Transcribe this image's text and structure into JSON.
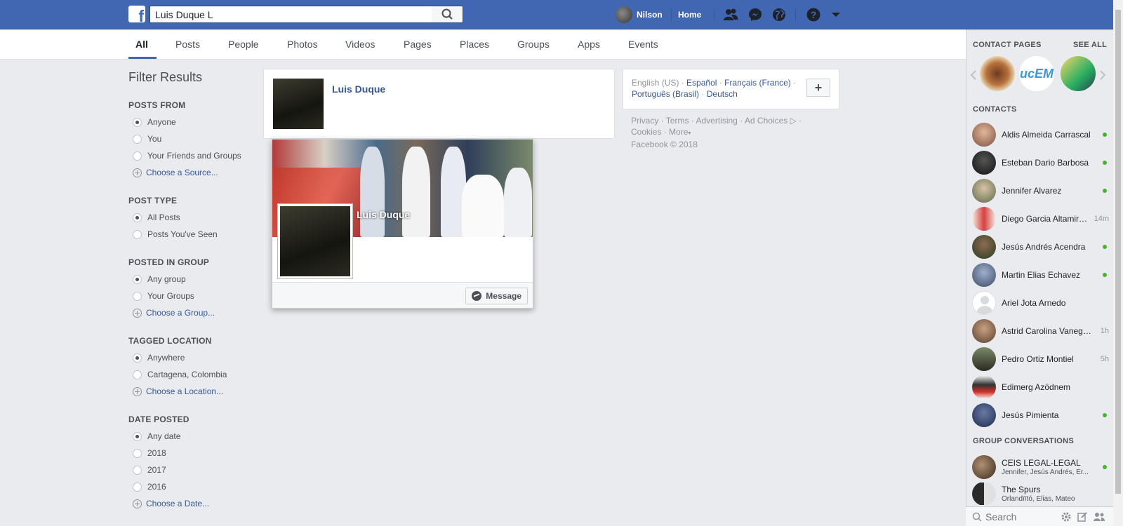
{
  "topbar": {
    "search_value": "Luis Duque L",
    "user_name": "Nilson",
    "home_label": "Home",
    "brand_color": "#4267b2"
  },
  "tabs": [
    {
      "label": "All",
      "active": true
    },
    {
      "label": "Posts"
    },
    {
      "label": "People"
    },
    {
      "label": "Photos"
    },
    {
      "label": "Videos"
    },
    {
      "label": "Pages"
    },
    {
      "label": "Places"
    },
    {
      "label": "Groups"
    },
    {
      "label": "Apps"
    },
    {
      "label": "Events"
    }
  ],
  "filters": {
    "title": "Filter Results",
    "posts_from": {
      "heading": "POSTS FROM",
      "options": [
        "Anyone",
        "You",
        "Your Friends and Groups"
      ],
      "selected": "Anyone",
      "link": "Choose a Source..."
    },
    "post_type": {
      "heading": "POST TYPE",
      "options": [
        "All Posts",
        "Posts You've Seen"
      ],
      "selected": "All Posts"
    },
    "posted_in_group": {
      "heading": "POSTED IN GROUP",
      "options": [
        "Any group",
        "Your Groups"
      ],
      "selected": "Any group",
      "link": "Choose a Group..."
    },
    "tagged_location": {
      "heading": "TAGGED LOCATION",
      "options": [
        "Anywhere",
        "Cartagena, Colombia"
      ],
      "selected": "Anywhere",
      "link": "Choose a Location..."
    },
    "date_posted": {
      "heading": "DATE POSTED",
      "options": [
        "Any date",
        "2018",
        "2017",
        "2016"
      ],
      "selected": "Any date",
      "link": "Choose a Date..."
    }
  },
  "result": {
    "name": "Luis Duque"
  },
  "hovercard": {
    "name": "Luis Duque",
    "message_label": "Message"
  },
  "languages": {
    "current": "English (US)",
    "others": [
      "Español",
      "Français (France)",
      "Português (Brasil)",
      "Deutsch"
    ],
    "sep": "·"
  },
  "footer": {
    "links": [
      "Privacy",
      "Terms",
      "Advertising",
      "Ad Choices",
      "Cookies",
      "More"
    ],
    "copyright": "Facebook © 2018"
  },
  "chat": {
    "contact_pages_heading": "CONTACT PAGES",
    "see_all": "SEE ALL",
    "contacts_heading": "CONTACTS",
    "contacts": [
      {
        "name": "Aldis Almeida Carrascal",
        "status": "",
        "online": true
      },
      {
        "name": "Esteban Dario Barbosa",
        "status": "",
        "online": true
      },
      {
        "name": "Jennifer Alvarez",
        "status": "",
        "online": true
      },
      {
        "name": "Diego Garcia Altamiranda",
        "status": "14m",
        "online": false
      },
      {
        "name": "Jesús Andrés Acendra",
        "status": "",
        "online": true
      },
      {
        "name": "Martin Elias Echavez",
        "status": "",
        "online": true
      },
      {
        "name": "Ariel Jota Arnedo",
        "status": "",
        "online": false
      },
      {
        "name": "Astrid Carolina Vanegas",
        "status": "1h",
        "online": false
      },
      {
        "name": "Pedro Ortiz Montiel",
        "status": "5h",
        "online": false
      },
      {
        "name": "Edimerg Azödnem",
        "status": "",
        "online": false
      },
      {
        "name": "Jesús Pimienta",
        "status": "",
        "online": true
      }
    ],
    "group_heading": "GROUP CONVERSATIONS",
    "groups": [
      {
        "name": "CEIS LEGAL-LEGAL",
        "members": "Jennifer, Jesús Andrés, Er...",
        "online": true
      },
      {
        "name": "The Spurs",
        "members": "Órlandïïtó, Elias, Mateo",
        "online": false
      }
    ],
    "search_placeholder": "Search"
  }
}
